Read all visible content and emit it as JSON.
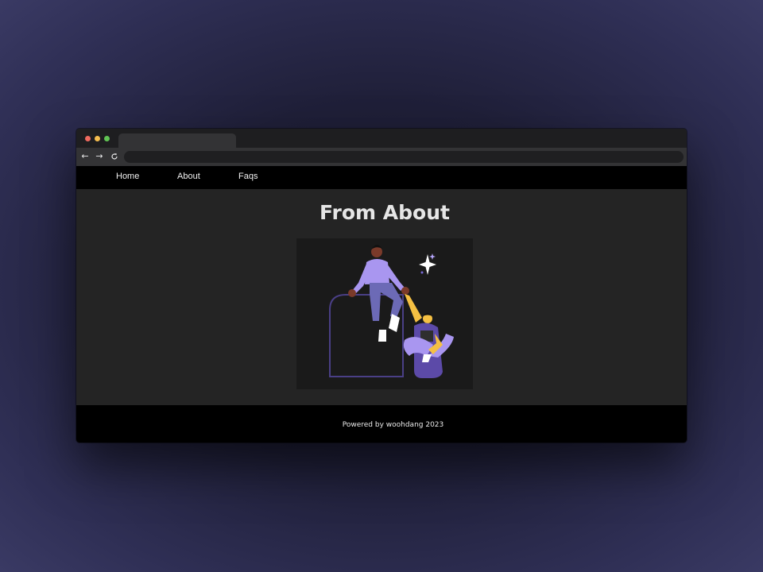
{
  "nav": {
    "items": [
      {
        "label": "Home"
      },
      {
        "label": "About"
      },
      {
        "label": "Faqs"
      }
    ]
  },
  "page": {
    "title": "From About"
  },
  "illustration": {
    "description_icon": "teamwork-helping-hand-illustration"
  },
  "footer": {
    "text": "Powered by woohdang 2023"
  },
  "colors": {
    "nav_bg": "#000000",
    "page_bg": "#242424",
    "accent_purple": "#a996f0",
    "accent_yellow": "#f5c043"
  }
}
